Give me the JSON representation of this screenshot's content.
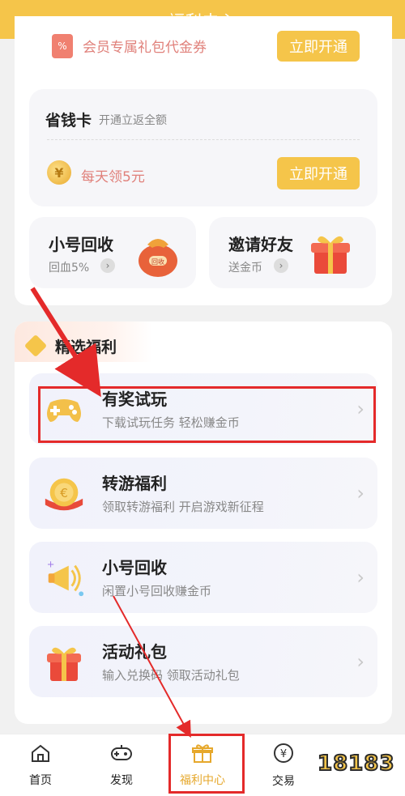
{
  "header": {
    "title": "福利中心"
  },
  "vip": {
    "badge": "%",
    "text": "会员专属礼包代金券",
    "button": "立即开通"
  },
  "saving_card": {
    "title": "省钱卡",
    "subtitle": "开通立返全额",
    "coin": "¥",
    "reward": "每天领5元",
    "button": "立即开通"
  },
  "mini_cards": [
    {
      "title": "小号回收",
      "subtitle": "回血5%",
      "icon": "money-bag-icon",
      "bag_label": "回收"
    },
    {
      "title": "邀请好友",
      "subtitle": "送金币",
      "icon": "gift-box-icon"
    }
  ],
  "section": {
    "title": "精选福利"
  },
  "welfare_list": [
    {
      "title": "有奖试玩",
      "subtitle": "下载试玩任务 轻松赚金币",
      "icon": "gamepad-icon"
    },
    {
      "title": "转游福利",
      "subtitle": "领取转游福利 开启游戏新征程",
      "icon": "coin-icon"
    },
    {
      "title": "小号回收",
      "subtitle": "闲置小号回收赚金币",
      "icon": "megaphone-icon"
    },
    {
      "title": "活动礼包",
      "subtitle": "输入兑换码 领取活动礼包",
      "icon": "gift-icon"
    }
  ],
  "tabbar": [
    {
      "label": "首页",
      "icon": "home-icon",
      "active": false
    },
    {
      "label": "发现",
      "icon": "discover-icon",
      "active": false
    },
    {
      "label": "福利中心",
      "icon": "gift-icon",
      "active": true
    },
    {
      "label": "交易",
      "icon": "trade-icon",
      "active": false
    }
  ],
  "watermark": {
    "text": "18183"
  },
  "colors": {
    "brand": "#f5c54a",
    "annotation": "#e42a2a",
    "active_tab": "#e6a82c"
  }
}
